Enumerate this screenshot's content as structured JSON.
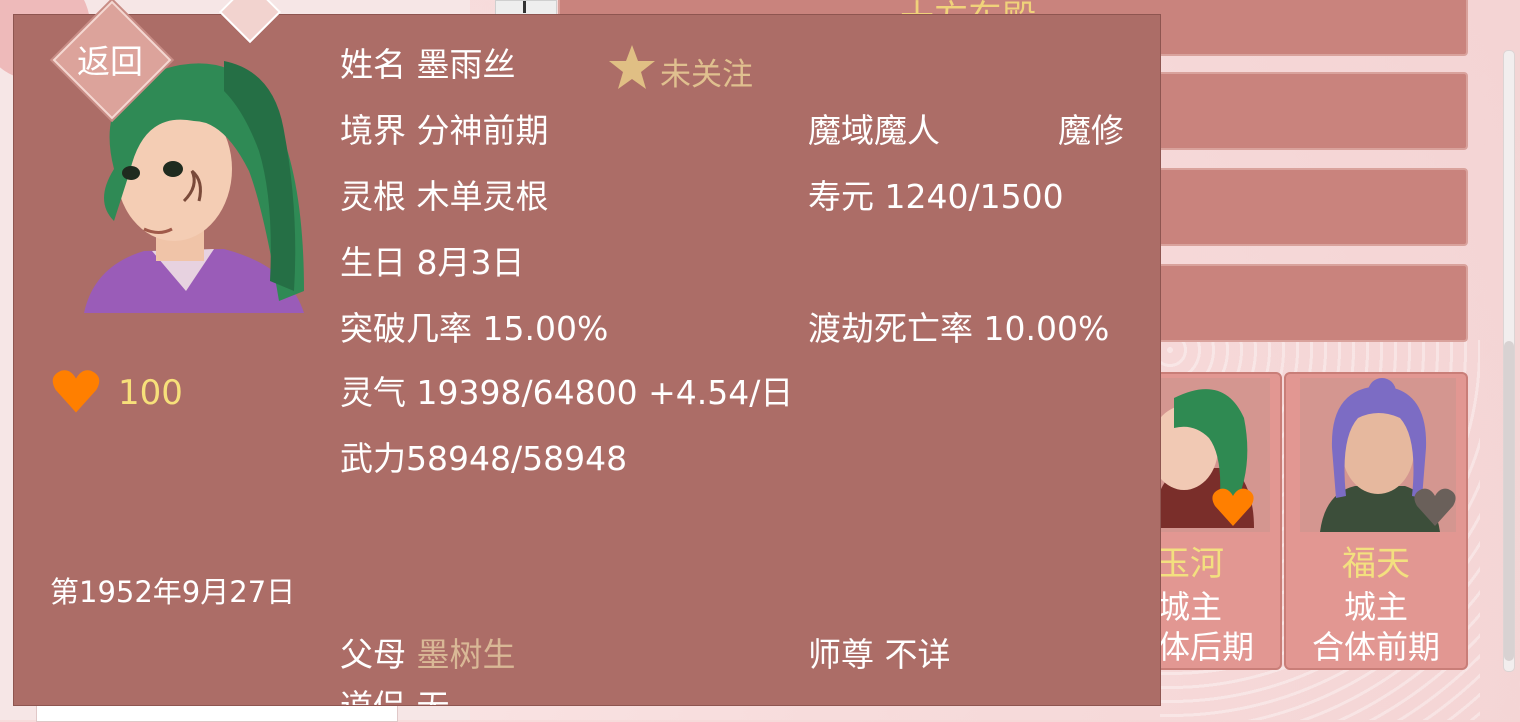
{
  "list": {
    "top_row_title": "十方东殿"
  },
  "cards": [
    {
      "name": "玉河",
      "role": "城主",
      "realm": "合体后期",
      "heart": "#ff7f00"
    },
    {
      "name": "福天",
      "role": "城主",
      "realm": "合体前期",
      "heart": "#6a605a"
    }
  ],
  "dialog": {
    "back_label": "返回",
    "follow_label": "未关注",
    "name_label": "姓名",
    "name": "墨雨丝",
    "realm_label": "境界",
    "realm": "分神前期",
    "race": "魔域魔人",
    "sect": "魔修",
    "root_label": "灵根",
    "root": "木单灵根",
    "lifespan_label": "寿元",
    "lifespan": "1240/1500",
    "birthday_label": "生日",
    "birthday": "8月3日",
    "breakthrough_label": "突破几率",
    "breakthrough": "15.00%",
    "tribulation_label": "渡劫死亡率",
    "tribulation": "10.00%",
    "qi_label": "灵气",
    "qi": "19398/64800 +4.54/日",
    "force_label": "武力",
    "force": "58948/58948",
    "parents_label": "父母",
    "parents": "墨树生",
    "master_label": "师尊",
    "master": "不详",
    "partner_label": "道侣",
    "partner": "无",
    "favor": "100",
    "date": "第1952年9月27日"
  },
  "colors": {
    "panel": "#ac6d67",
    "gold_text": "#f7e07a",
    "heart_orange": "#ff7f00",
    "heart_gray": "#6a605a",
    "muted_link": "#d9b896"
  },
  "icons": {
    "back": "diamond-button",
    "follow": "star-icon",
    "favor": "heart-icon"
  }
}
